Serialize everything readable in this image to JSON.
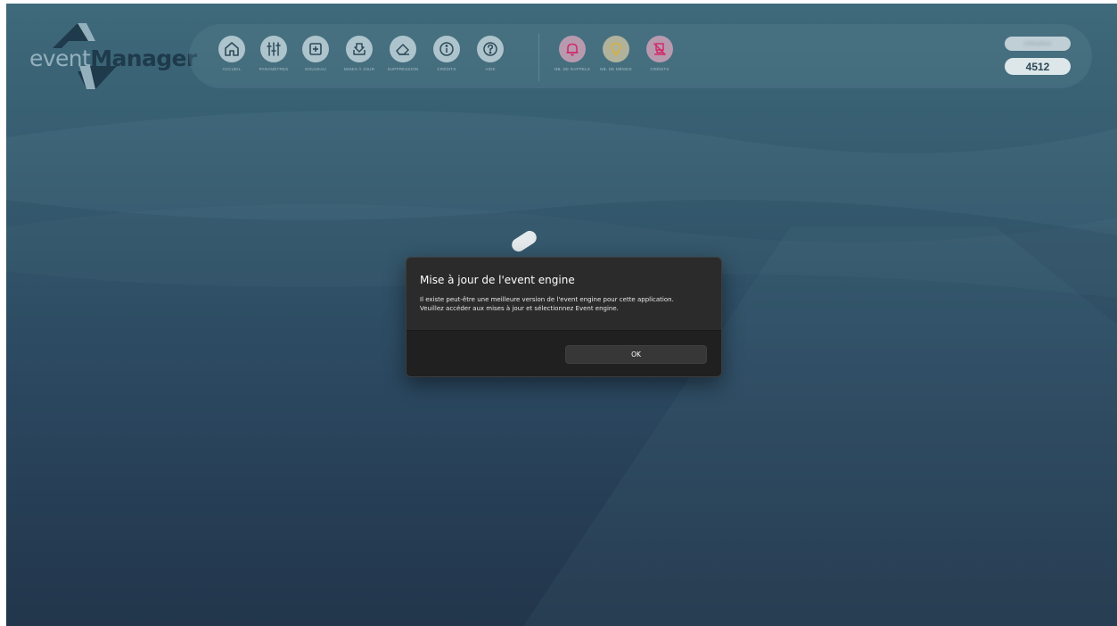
{
  "logo": {
    "text_prefix": "event",
    "text_suffix": "Manager"
  },
  "toolbar": {
    "buttons": [
      {
        "label": "ACCUEIL",
        "icon": "home-icon"
      },
      {
        "label": "PARAMÈTRES",
        "icon": "sliders-icon"
      },
      {
        "label": "NOUVEAU",
        "icon": "plus-square-icon"
      },
      {
        "label": "MISES À JOUR",
        "icon": "download-tray-icon"
      },
      {
        "label": "SUPPRESSION",
        "icon": "eraser-icon"
      },
      {
        "label": "CRÉDITS",
        "icon": "info-icon"
      },
      {
        "label": "AIDE",
        "icon": "help-icon"
      }
    ],
    "extra_buttons": [
      {
        "label": "NB. DE RAPPELS",
        "icon": "bell-icon"
      },
      {
        "label": "NB. DE MÉMOS",
        "icon": "lightbulb-icon"
      },
      {
        "label": "CRÉDITS",
        "icon": "license-off-icon"
      }
    ],
    "user_name": "Utilisateur",
    "counter": "4512"
  },
  "dialog": {
    "title": "Mise à jour de l'event engine",
    "message_line1": "Il existe peut-être une meilleure version de l'event engine pour cette application.",
    "message_line2": "Veuillez accéder aux mises à jour et sélectionnez Event engine.",
    "ok_label": "OK"
  },
  "colors": {
    "background_top": "#3e6a7b",
    "background_bottom": "#22354b",
    "icon_circle": "#aec4cc",
    "alert_circle": "#b89aaf",
    "alert_icon": "#d02a6a",
    "bulb_circle": "#b0b29c",
    "bulb_icon": "#d8b13a",
    "dialog_bg": "#2b2b2b"
  }
}
